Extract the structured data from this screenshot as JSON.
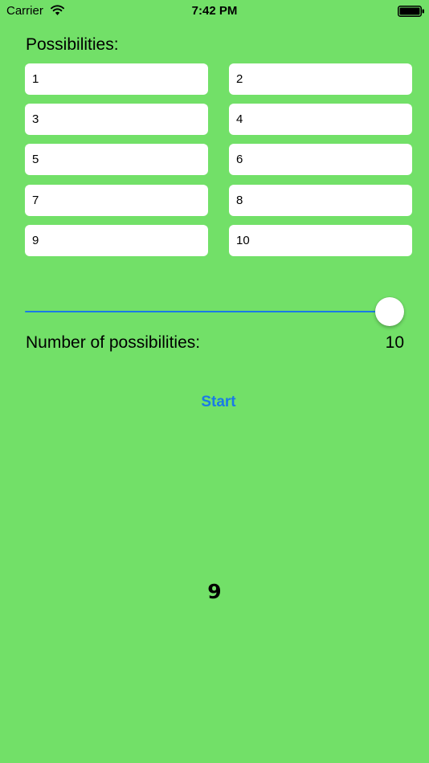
{
  "status_bar": {
    "carrier": "Carrier",
    "time": "7:42 PM",
    "icons": [
      "wifi-icon",
      "battery-icon"
    ]
  },
  "possibilities": {
    "label": "Possibilities:",
    "fields": [
      "1",
      "2",
      "3",
      "4",
      "5",
      "6",
      "7",
      "8",
      "9",
      "10"
    ]
  },
  "slider": {
    "value": 10,
    "min": 1,
    "max": 10,
    "fill_fraction": 1.0
  },
  "count": {
    "label": "Number of possibilities:",
    "value": "10"
  },
  "start_button": {
    "label": "Start"
  },
  "result": {
    "value": "9"
  },
  "colors": {
    "background": "#72e068",
    "accent": "#1a7ae6",
    "field_background": "#ffffff"
  }
}
